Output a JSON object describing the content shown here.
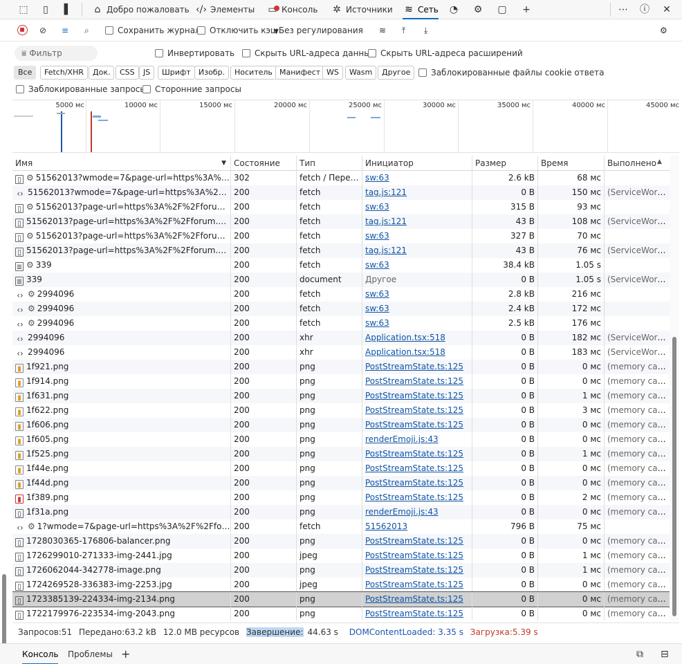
{
  "tabs": [
    {
      "label": "Добро пожаловать",
      "icon": "home-icon"
    },
    {
      "label": "Элементы",
      "icon": "code-brackets-icon"
    },
    {
      "label": "Консоль",
      "icon": "console-icon"
    },
    {
      "label": "Источники",
      "icon": "bug-icon"
    },
    {
      "label": "Сеть",
      "icon": "wifi-icon"
    }
  ],
  "toolbar": {
    "preserve_log": "Сохранить журнал",
    "disable_cache": "Отключить кэш",
    "throttling": "Без регулирования"
  },
  "filter": {
    "placeholder": "Фильтр",
    "invert": "Инвертировать",
    "hide_data_urls": "Скрыть URL-адреса данных",
    "hide_ext_urls": "Скрыть URL-адреса расширений",
    "blocked_cookies": "Заблокированные файлы cookie ответа",
    "blocked_requests": "Заблокированные запросы",
    "third_party": "Сторонние запросы",
    "types": [
      "Все",
      "Fetch/XHR",
      "Док.",
      "CSS",
      "JS",
      "Шрифт",
      "Изобр.",
      "Носитель",
      "Манифест",
      "WS",
      "Wasm",
      "Другое"
    ]
  },
  "overview": {
    "labels": [
      "5000 мс",
      "10000 мс",
      "15000 мс",
      "20000 мс",
      "25000 мс",
      "30000 мс",
      "35000 мс",
      "40000 мс",
      "45000 мс"
    ]
  },
  "table": {
    "headers": [
      "Имя",
      "Состояние",
      "Тип",
      "Инициатор",
      "Размер",
      "Время",
      "Выполнено"
    ],
    "rows": [
      {
        "icon": "doc",
        "gear": true,
        "name": "51562013?wmode=7&page-url=https%3A%2F%2...",
        "status": "302",
        "type": "fetch / Перен...",
        "init": "sw:63",
        "link": true,
        "size": "2.6 kB",
        "time": "68 мс",
        "done": ""
      },
      {
        "icon": "code",
        "gear": false,
        "name": "51562013?wmode=7&page-url=https%3A%2F%2Ffo...",
        "status": "200",
        "type": "fetch",
        "init": "tag.js:121",
        "link": true,
        "size": "0 B",
        "time": "150 мс",
        "done": "(ServiceWorker)"
      },
      {
        "icon": "doc",
        "gear": true,
        "name": "51562013?page-url=https%3A%2F%2Fforum.exbo....",
        "status": "200",
        "type": "fetch",
        "init": "sw:63",
        "link": true,
        "size": "315 B",
        "time": "93 мс",
        "done": ""
      },
      {
        "icon": "doc",
        "gear": false,
        "name": "51562013?page-url=https%3A%2F%2Fforum.exbo.n...",
        "status": "200",
        "type": "fetch",
        "init": "tag.js:121",
        "link": true,
        "size": "43 B",
        "time": "108 мс",
        "done": "(ServiceWorker)"
      },
      {
        "icon": "doc",
        "gear": true,
        "name": "51562013?page-url=https%3A%2F%2Fforum.exbo....",
        "status": "200",
        "type": "fetch",
        "init": "sw:63",
        "link": true,
        "size": "327 B",
        "time": "70 мс",
        "done": ""
      },
      {
        "icon": "doc",
        "gear": false,
        "name": "51562013?page-url=https%3A%2F%2Fforum.exbo.n...",
        "status": "200",
        "type": "fetch",
        "init": "tag.js:121",
        "link": true,
        "size": "43 B",
        "time": "76 мс",
        "done": "(ServiceWorker)"
      },
      {
        "icon": "list",
        "gear": true,
        "name": "339",
        "status": "200",
        "type": "fetch",
        "init": "sw:63",
        "link": true,
        "size": "38.4 kB",
        "time": "1.05 s",
        "done": ""
      },
      {
        "icon": "list",
        "gear": false,
        "name": "339",
        "status": "200",
        "type": "document",
        "init": "Другое",
        "link": false,
        "size": "0 B",
        "time": "1.05 s",
        "done": "(ServiceWorker)"
      },
      {
        "icon": "code",
        "gear": true,
        "name": "2994096",
        "status": "200",
        "type": "fetch",
        "init": "sw:63",
        "link": true,
        "size": "2.8 kB",
        "time": "216 мс",
        "done": ""
      },
      {
        "icon": "code",
        "gear": true,
        "name": "2994096",
        "status": "200",
        "type": "fetch",
        "init": "sw:63",
        "link": true,
        "size": "2.4 kB",
        "time": "172 мс",
        "done": ""
      },
      {
        "icon": "code",
        "gear": true,
        "name": "2994096",
        "status": "200",
        "type": "fetch",
        "init": "sw:63",
        "link": true,
        "size": "2.5 kB",
        "time": "176 мс",
        "done": ""
      },
      {
        "icon": "code",
        "gear": false,
        "name": "2994096",
        "status": "200",
        "type": "xhr",
        "init": "Application.tsx:518",
        "link": true,
        "size": "0 B",
        "time": "182 мс",
        "done": "(ServiceWorker)"
      },
      {
        "icon": "code",
        "gear": false,
        "name": "2994096",
        "status": "200",
        "type": "xhr",
        "init": "Application.tsx:518",
        "link": true,
        "size": "0 B",
        "time": "183 мс",
        "done": "(ServiceWorker)"
      },
      {
        "icon": "img",
        "gear": false,
        "name": "1f921.png",
        "status": "200",
        "type": "png",
        "init": "PostStreamState.ts:125",
        "link": true,
        "size": "0 B",
        "time": "0 мс",
        "done": "(memory cache)"
      },
      {
        "icon": "img",
        "gear": false,
        "name": "1f914.png",
        "status": "200",
        "type": "png",
        "init": "PostStreamState.ts:125",
        "link": true,
        "size": "0 B",
        "time": "0 мс",
        "done": "(memory cache)"
      },
      {
        "icon": "img",
        "gear": false,
        "name": "1f631.png",
        "status": "200",
        "type": "png",
        "init": "PostStreamState.ts:125",
        "link": true,
        "size": "0 B",
        "time": "1 мс",
        "done": "(memory cache)"
      },
      {
        "icon": "img",
        "gear": false,
        "name": "1f622.png",
        "status": "200",
        "type": "png",
        "init": "PostStreamState.ts:125",
        "link": true,
        "size": "0 B",
        "time": "3 мс",
        "done": "(memory cache)"
      },
      {
        "icon": "img",
        "gear": false,
        "name": "1f606.png",
        "status": "200",
        "type": "png",
        "init": "PostStreamState.ts:125",
        "link": true,
        "size": "0 B",
        "time": "0 мс",
        "done": "(memory cache)"
      },
      {
        "icon": "img",
        "gear": false,
        "name": "1f605.png",
        "status": "200",
        "type": "png",
        "init": "renderEmoji.js:43",
        "link": true,
        "size": "0 B",
        "time": "0 мс",
        "done": "(memory cache)"
      },
      {
        "icon": "img",
        "gear": false,
        "name": "1f525.png",
        "status": "200",
        "type": "png",
        "init": "PostStreamState.ts:125",
        "link": true,
        "size": "0 B",
        "time": "1 мс",
        "done": "(memory cache)"
      },
      {
        "icon": "img",
        "gear": false,
        "name": "1f44e.png",
        "status": "200",
        "type": "png",
        "init": "PostStreamState.ts:125",
        "link": true,
        "size": "0 B",
        "time": "0 мс",
        "done": "(memory cache)"
      },
      {
        "icon": "img",
        "gear": false,
        "name": "1f44d.png",
        "status": "200",
        "type": "png",
        "init": "PostStreamState.ts:125",
        "link": true,
        "size": "0 B",
        "time": "0 мс",
        "done": "(memory cache)"
      },
      {
        "icon": "pdf",
        "gear": false,
        "name": "1f389.png",
        "status": "200",
        "type": "png",
        "init": "PostStreamState.ts:125",
        "link": true,
        "size": "0 B",
        "time": "2 мс",
        "done": "(memory cache)"
      },
      {
        "icon": "doc",
        "gear": false,
        "name": "1f31a.png",
        "status": "200",
        "type": "png",
        "init": "renderEmoji.js:43",
        "link": true,
        "size": "0 B",
        "time": "0 мс",
        "done": "(memory cache)"
      },
      {
        "icon": "code",
        "gear": true,
        "name": "1?wmode=7&page-url=https%3A%2F%2Fforum.e...",
        "status": "200",
        "type": "fetch",
        "init": "51562013",
        "link": true,
        "size": "796 B",
        "time": "75 мс",
        "done": ""
      },
      {
        "icon": "doc",
        "gear": false,
        "name": "1728030365-176806-balancer.png",
        "status": "200",
        "type": "png",
        "init": "PostStreamState.ts:125",
        "link": true,
        "size": "0 B",
        "time": "0 мс",
        "done": "(memory cache)"
      },
      {
        "icon": "doc",
        "gear": false,
        "name": "1726299010-271333-img-2441.jpg",
        "status": "200",
        "type": "jpeg",
        "init": "PostStreamState.ts:125",
        "link": true,
        "size": "0 B",
        "time": "1 мс",
        "done": "(memory cache)"
      },
      {
        "icon": "doc",
        "gear": false,
        "name": "1726062044-342778-image.png",
        "status": "200",
        "type": "png",
        "init": "PostStreamState.ts:125",
        "link": true,
        "size": "0 B",
        "time": "1 мс",
        "done": "(memory cache)"
      },
      {
        "icon": "doc",
        "gear": false,
        "name": "1724269528-336383-img-2253.jpg",
        "status": "200",
        "type": "jpeg",
        "init": "PostStreamState.ts:125",
        "link": true,
        "size": "0 B",
        "time": "0 мс",
        "done": "(memory cache)"
      },
      {
        "icon": "doc",
        "gear": false,
        "name": "1723385139-224334-img-2134.png",
        "status": "200",
        "type": "png",
        "init": "PostStreamState.ts:125",
        "link": true,
        "size": "0 B",
        "time": "0 мс",
        "done": "(memory cache)",
        "selected": true
      },
      {
        "icon": "doc",
        "gear": false,
        "name": "1722179976-223534-img-2043.png",
        "status": "200",
        "type": "png",
        "init": "PostStreamState.ts:125",
        "link": true,
        "size": "0 B",
        "time": "0 мс",
        "done": "(memory cache)"
      }
    ]
  },
  "status": {
    "requests": "Запросов:51",
    "transferred": "Передано:63.2 kB",
    "resources": "12.0 MB ресурсов",
    "finish_label": "Завершение:",
    "finish_value": "44.63 s",
    "dcl": "DOMContentLoaded: 3.35 s",
    "load": "Загрузка:5.39 s"
  },
  "drawer": {
    "console": "Консоль",
    "issues": "Проблемы"
  },
  "colors": {
    "accent": "#0f6cbd",
    "link": "#0f54a6",
    "load": "#c0392b",
    "dcl": "#1a56b0"
  }
}
